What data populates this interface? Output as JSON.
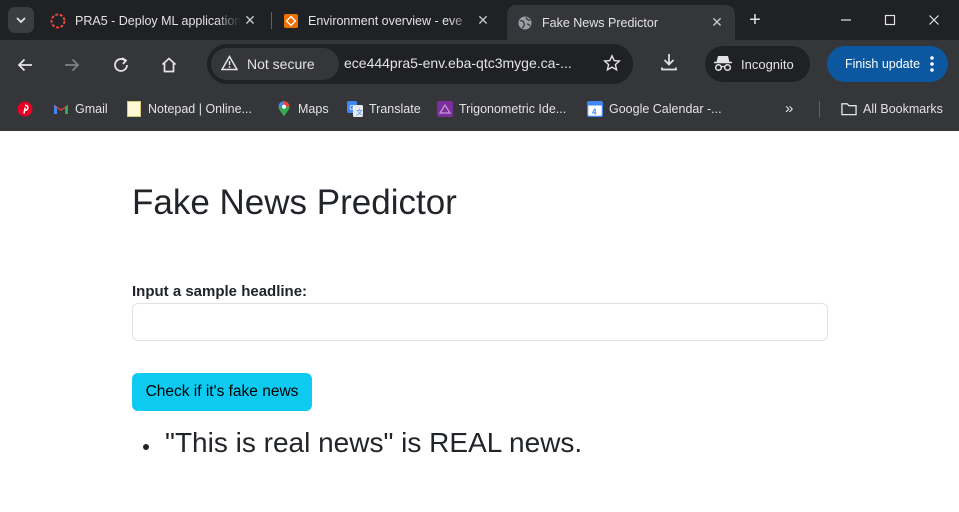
{
  "browser": {
    "tabs": [
      {
        "title": "PRA5 - Deploy ML application",
        "icon": "pra5-logo-icon",
        "active": false
      },
      {
        "title": "Environment overview - eve",
        "icon": "aws-beanstalk-icon",
        "active": false
      },
      {
        "title": "Fake News Predictor",
        "icon": "globe-icon",
        "active": true
      }
    ],
    "new_tab_label": "+",
    "security_label": "Not secure",
    "url": "ece444pra5-env.eba-qtc3myge.ca-...",
    "incognito_label": "Incognito",
    "finish_update_label": "Finish update",
    "bookmarks": [
      {
        "label": "",
        "icon": "pinterest-icon"
      },
      {
        "label": "Gmail",
        "icon": "gmail-icon"
      },
      {
        "label": "Notepad | Online...",
        "icon": "notepad-icon"
      },
      {
        "label": "Maps",
        "icon": "maps-icon"
      },
      {
        "label": "Translate",
        "icon": "translate-icon"
      },
      {
        "label": "Trigonometric Ide...",
        "icon": "trig-icon"
      },
      {
        "label": "Google Calendar -...",
        "icon": "calendar-icon"
      }
    ],
    "more_bookmarks": "»",
    "all_bookmarks_label": "All Bookmarks",
    "colors": {
      "tabstrip": "#202124",
      "toolbar": "#35363a",
      "finish_button": "#0b57a0"
    }
  },
  "page": {
    "title": "Fake News Predictor",
    "input_label": "Input a sample headline:",
    "input_value": "",
    "submit_label": "Check if it's fake news",
    "results": [
      "\"This is real news\" is REAL news."
    ],
    "colors": {
      "button": "#0dcaf0",
      "text": "#212529"
    }
  }
}
